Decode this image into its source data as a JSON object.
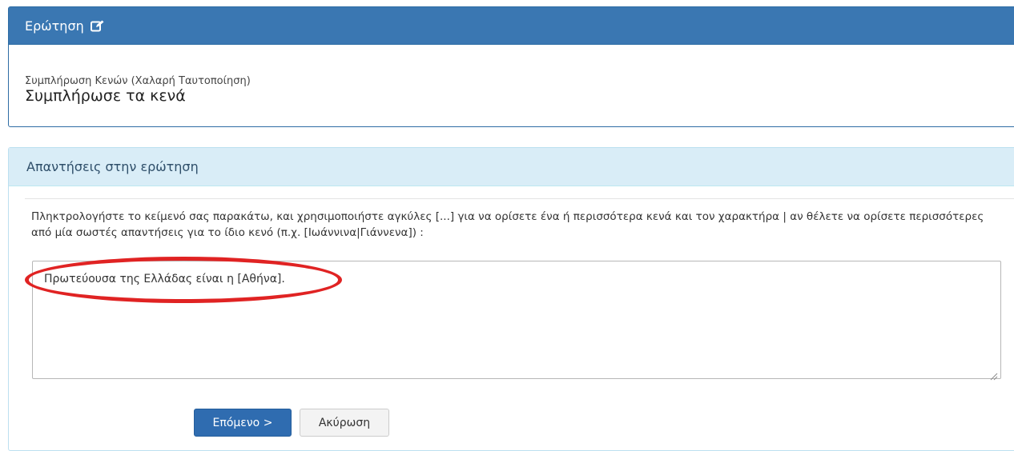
{
  "question_panel": {
    "title": "Ερώτηση",
    "icon": "edit-icon",
    "type_label": "Συμπλήρωση Κενών (Χαλαρή Ταυτοποίηση)",
    "question_text": "Συμπλήρωσε τα κενά"
  },
  "answers_panel": {
    "title": "Απαντήσεις στην ερώτηση",
    "instructions": "Πληκτρολογήστε το κείμενό σας παρακάτω, και χρησιμοποιήστε αγκύλες [...] για να ορίσετε ένα ή περισσότερα κενά και τον χαρακτήρα | αν θέλετε να ορίσετε περισσότερες από μία σωστές απαντήσεις για το ίδιο κενό (π.χ. [Ιωάννινα|Γιάννενα]) :",
    "answer_value": "Πρωτεύουσα της Ελλάδας είναι η [Αθήνα]."
  },
  "buttons": {
    "next_label": "Επόμενο >",
    "cancel_label": "Ακύρωση"
  },
  "colors": {
    "primary_header": "#3a77b2",
    "info_header": "#d9edf7",
    "highlight": "#e02323"
  }
}
